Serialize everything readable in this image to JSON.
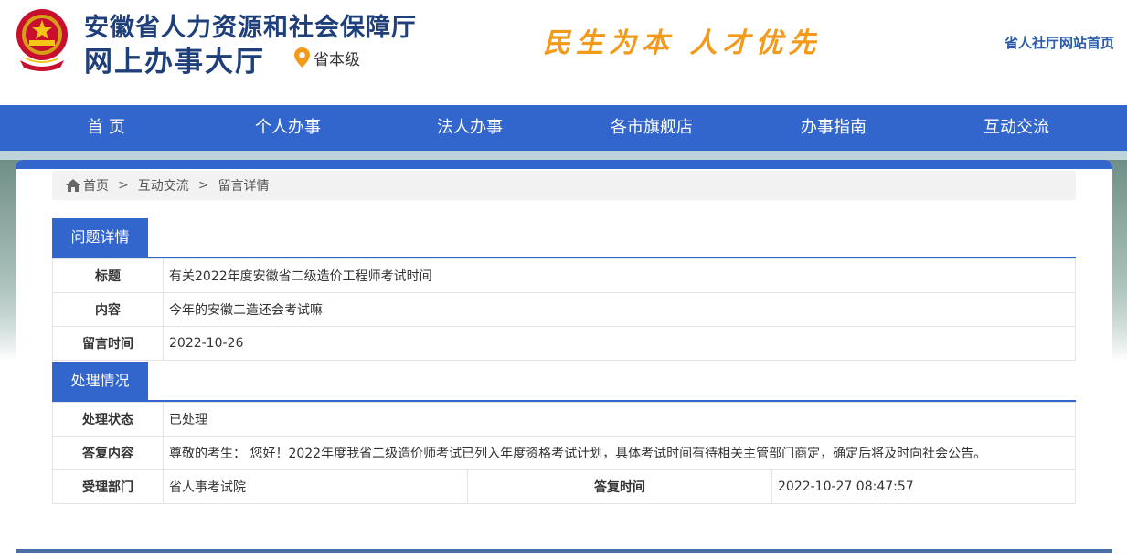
{
  "header": {
    "title_line1": "安徽省人力资源和社会保障厅",
    "title_line2": "网上办事大厅",
    "location": "省本级",
    "slogan": "民生为本 人才优先",
    "home_link": "省人社厅网站首页",
    "icons": {
      "emblem": "national-emblem-icon",
      "location": "map-pin-icon"
    },
    "colors": {
      "title": "#1f3f7a",
      "slogan": "#f39a1a",
      "link": "#2a5caa",
      "pin": "#f39a1a"
    }
  },
  "nav": {
    "items": [
      {
        "label": "首 页"
      },
      {
        "label": "个人办事"
      },
      {
        "label": "法人办事"
      },
      {
        "label": "各市旗舰店"
      },
      {
        "label": "办事指南"
      },
      {
        "label": "互动交流"
      }
    ],
    "color": "#3366cc"
  },
  "breadcrumb": {
    "home": "首页",
    "sep": ">",
    "level2": "互动交流",
    "current": "留言详情",
    "icon": "home-icon"
  },
  "question": {
    "section_title": "问题详情",
    "rows": [
      {
        "label": "标题",
        "value": "有关2022年度安徽省二级造价工程师考试时间"
      },
      {
        "label": "内容",
        "value": "今年的安徽二造还会考试嘛"
      },
      {
        "label": "留言时间",
        "value": "2022-10-26"
      }
    ]
  },
  "handling": {
    "section_title": "处理情况",
    "status_label": "处理状态",
    "status_value": "已处理",
    "reply_label": "答复内容",
    "reply_value": "尊敬的考生： 您好！2022年度我省二级造价师考试已列入年度资格考试计划，具体考试时间有待相关主管部门商定，确定后将及时向社会公告。",
    "dept_label": "受理部门",
    "dept_value": "省人事考试院",
    "time_label": "答复时间",
    "time_value": "2022-10-27 08:47:57"
  }
}
